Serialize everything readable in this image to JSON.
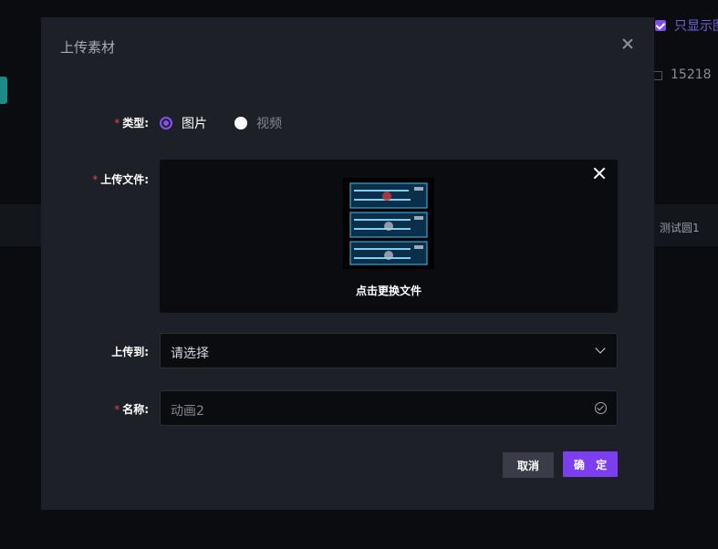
{
  "background": {
    "only_show_label": "只显示图",
    "count": "15218",
    "row_name": "测试圆1"
  },
  "modal": {
    "title": "上传素材",
    "type": {
      "label": "类型:",
      "required": "*",
      "options": [
        {
          "label": "图片",
          "selected": true
        },
        {
          "label": "视频",
          "selected": false
        }
      ]
    },
    "file": {
      "label": "上传文件:",
      "required": "*",
      "change_text": "点击更换文件"
    },
    "target": {
      "label": "上传到:",
      "placeholder": "请选择"
    },
    "name": {
      "label": "名称:",
      "required": "*",
      "value": "动画2"
    },
    "buttons": {
      "cancel": "取消",
      "confirm": "确 定"
    }
  },
  "colors": {
    "accent": "#7b3ff0",
    "required": "#e0443b",
    "modal_bg": "#1e2028"
  }
}
